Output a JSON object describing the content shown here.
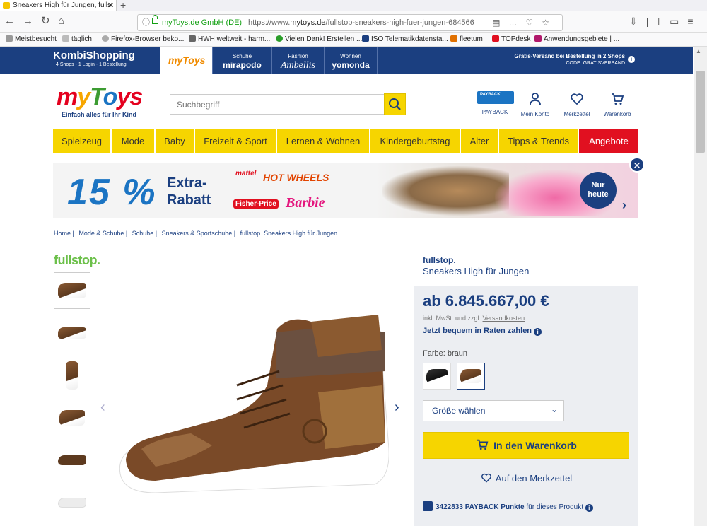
{
  "browser": {
    "tab_title": "Sneakers High für Jungen, fullst",
    "url_org": "myToys.de GmbH (DE)",
    "url_prefix": "https://www.",
    "url_domain": "mytoys.de",
    "url_path": "/fullstop-sneakers-high-fuer-jungen-684566",
    "bookmarks": [
      "Meistbesucht",
      "täglich",
      "Firefox-Browser beko...",
      "HWH weltweit - harm...",
      "Vielen Dank! Erstellen ...",
      "ISO Telematikdatensta...",
      "fleetum",
      "TOPdesk",
      "Anwendungsgebiete | ..."
    ]
  },
  "kombi": {
    "logo": "KombiShopping",
    "sub": "4 Shops - 1 Login - 1 Bestellung",
    "shop_mytoys": "myToys",
    "shops": [
      {
        "small": "Schuhe",
        "big": "mirapodo"
      },
      {
        "small": "Fashion",
        "big": "Ambellis"
      },
      {
        "small": "Wohnen",
        "big": "yomonda"
      }
    ],
    "gratis_line1": "Gratis-Versand bei Bestellung in 2 Shops",
    "gratis_line2": "CODE: GRATISVERSAND"
  },
  "header": {
    "logo_letters": [
      "m",
      "y",
      "T",
      "o",
      "ys"
    ],
    "tagline": "Einfach alles für Ihr Kind",
    "search_placeholder": "Suchbegriff",
    "payback_badge": "PAYBACK",
    "icons": [
      {
        "label": "PAYBACK"
      },
      {
        "label": "Mein Konto"
      },
      {
        "label": "Merkzettel"
      },
      {
        "label": "Warenkorb"
      }
    ]
  },
  "nav": [
    "Spielzeug",
    "Mode",
    "Baby",
    "Freizeit & Sport",
    "Lernen & Wohnen",
    "Kindergeburtstag",
    "Alter",
    "Tipps & Trends",
    "Angebote"
  ],
  "banner": {
    "percent": "15 %",
    "extra": "Extra-",
    "rabatt": "Rabatt",
    "brands": [
      "mattel",
      "HOT WHEELS",
      "Fisher-Price",
      "Barbie"
    ],
    "nur": "Nur",
    "heute": "heute"
  },
  "breadcrumb": [
    "Home |",
    "Mode & Schuhe |",
    "Schuhe |",
    "Sneakers & Sportschuhe |",
    "fullstop. Sneakers High für Jungen"
  ],
  "product": {
    "brand_logo": "fullstop.",
    "brand": "fullstop.",
    "name": "Sneakers High für Jungen",
    "price": "ab 6.845.667,00 €",
    "vat_text": "inkl. MwSt. und zzgl. ",
    "vat_link": "Versandkosten",
    "raten": "Jetzt bequem in Raten zahlen",
    "farbe": "Farbe: braun",
    "size_placeholder": "Größe wählen",
    "cart_label": "In den Warenkorb",
    "merk_label": "Auf den Merkzettel",
    "points_value": "3422833 PAYBACK Punkte",
    "points_suffix": " für dieses Produkt"
  },
  "colors": {
    "brand_blue": "#1b3f80",
    "yellow": "#f6d500",
    "red": "#e11020"
  }
}
